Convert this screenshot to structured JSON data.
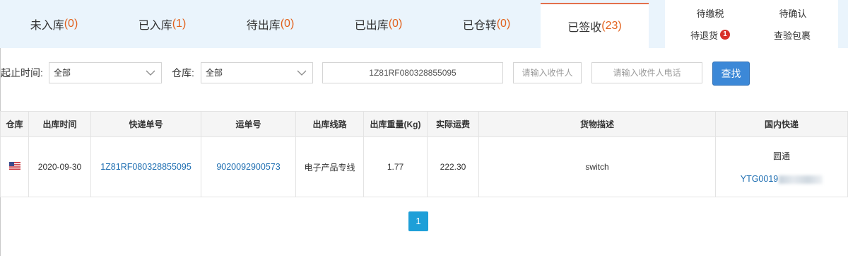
{
  "tabs": [
    {
      "label": "未入库",
      "count": "(0)",
      "active": false
    },
    {
      "label": "已入库",
      "count": "(1)",
      "active": false
    },
    {
      "label": "待出库",
      "count": "(0)",
      "active": false
    },
    {
      "label": "已出库",
      "count": "(0)",
      "active": false
    },
    {
      "label": "已仓转",
      "count": "(0)",
      "active": false
    },
    {
      "label": "已签收",
      "count": "(23)",
      "active": true
    }
  ],
  "side_panel": {
    "items": [
      {
        "label": "待缴税"
      },
      {
        "label": "待确认"
      },
      {
        "label": "待退货",
        "badge": "1"
      },
      {
        "label": "查验包裹"
      }
    ]
  },
  "filters": {
    "date_label": "起止时间:",
    "date_value": "全部",
    "warehouse_label": "仓库:",
    "warehouse_value": "全部",
    "tracking_value": "1Z81RF080328855095",
    "recipient_placeholder": "请输入收件人",
    "phone_placeholder": "请输入收件人电话",
    "search_label": "查找"
  },
  "table": {
    "headers": [
      "仓库",
      "出库时间",
      "快递单号",
      "运单号",
      "出库线路",
      "出库重量(Kg)",
      "实际运费",
      "货物描述",
      "国内快递"
    ],
    "rows": [
      {
        "warehouse_flag": "us-flag-icon",
        "ship_date": "2020-09-30",
        "express_no": "1Z81RF080328855095",
        "waybill_no": "9020092900573",
        "route": "电子产品专线",
        "weight": "1.77",
        "freight": "222.30",
        "description": "switch",
        "domestic_carrier": "圆通",
        "domestic_tracking": "YTG0019"
      }
    ]
  },
  "pagination": {
    "current": "1"
  },
  "colors": {
    "tab_bar_bg": "#eaf4fc",
    "count_orange": "#e2611c",
    "active_tab_border": "#e3704c",
    "link_blue": "#1f6fb2",
    "search_button": "#3c88d7",
    "page_button": "#1e9fd8",
    "badge_red": "#d8312a"
  }
}
